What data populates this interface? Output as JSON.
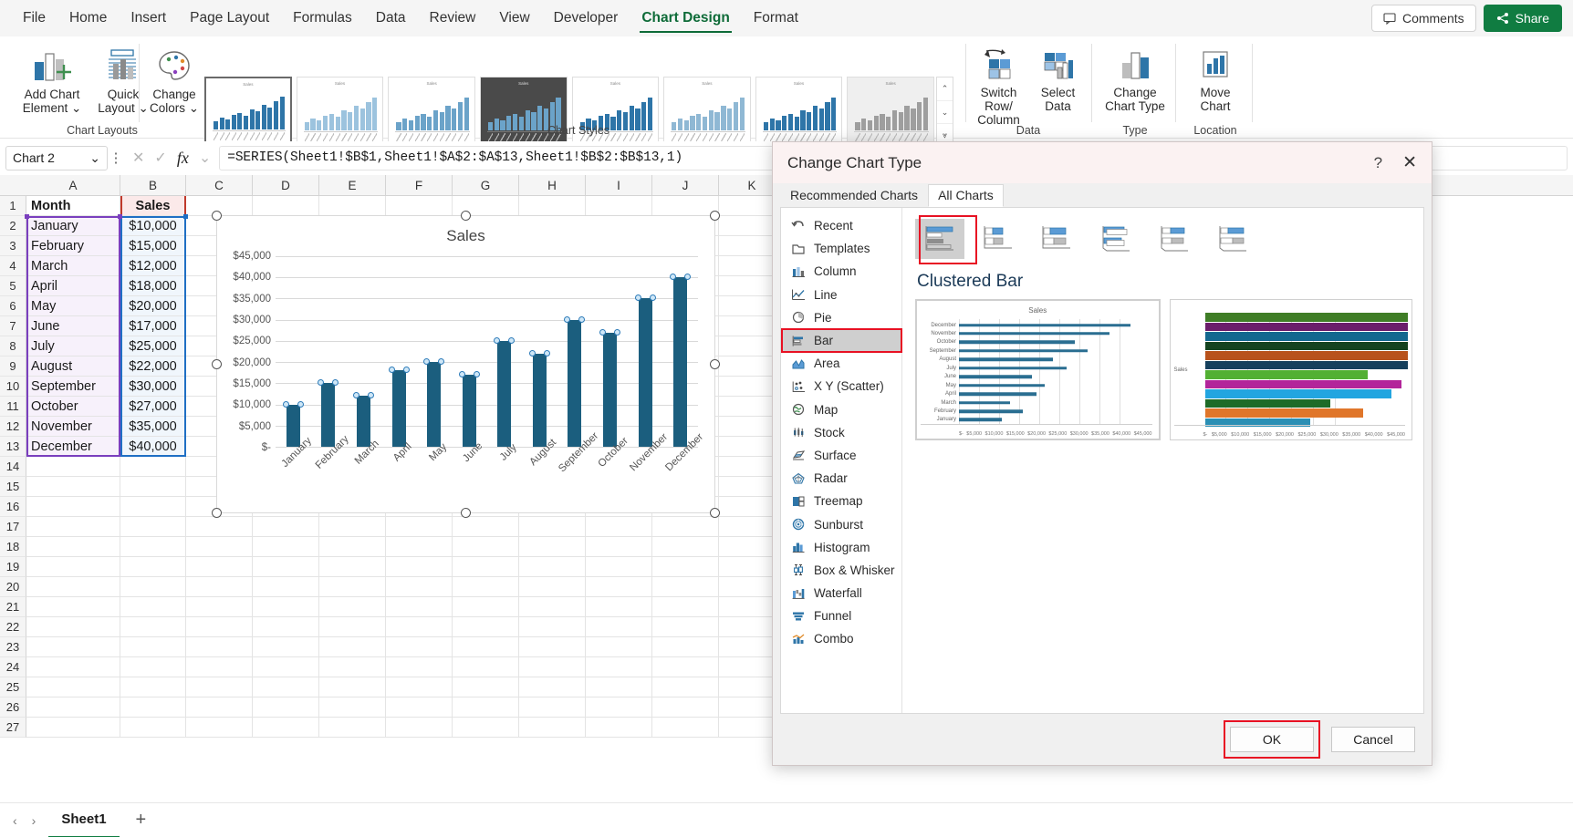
{
  "ribbon": {
    "tabs": [
      {
        "label": "File",
        "active": false
      },
      {
        "label": "Home",
        "active": false
      },
      {
        "label": "Insert",
        "active": false
      },
      {
        "label": "Page Layout",
        "active": false
      },
      {
        "label": "Formulas",
        "active": false
      },
      {
        "label": "Data",
        "active": false
      },
      {
        "label": "Review",
        "active": false
      },
      {
        "label": "View",
        "active": false
      },
      {
        "label": "Developer",
        "active": false
      },
      {
        "label": "Chart Design",
        "active": true
      },
      {
        "label": "Format",
        "active": false
      }
    ],
    "comments_label": "Comments",
    "share_label": "Share",
    "buttons": {
      "add_chart_element": "Add Chart\nElement",
      "add_chart_element_l1": "Add Chart",
      "add_chart_element_l2": "Element",
      "quick_layout_l1": "Quick",
      "quick_layout_l2": "Layout",
      "change_colors_l1": "Change",
      "change_colors_l2": "Colors",
      "switch_row_column_l1": "Switch Row/",
      "switch_row_column_l2": "Column",
      "select_data_l1": "Select",
      "select_data_l2": "Data",
      "change_chart_type_l1": "Change",
      "change_chart_type_l2": "Chart Type",
      "move_chart_l1": "Move",
      "move_chart_l2": "Chart"
    },
    "groups": {
      "chart_layouts": "Chart Layouts",
      "chart_styles": "Chart Styles",
      "data": "Data",
      "type": "Type",
      "location": "Location"
    },
    "gallery_thumb_title": "Sales"
  },
  "formula_bar": {
    "name_box_value": "Chart 2",
    "formula": "=SERIES(Sheet1!$B$1,Sheet1!$A$2:$A$13,Sheet1!$B$2:$B$13,1)",
    "cancel_icon": "✕",
    "confirm_icon": "✓",
    "fx_label": "fx",
    "dropdown_icon": "⌄"
  },
  "sheet": {
    "column_headers": [
      "A",
      "B",
      "C",
      "D",
      "E",
      "F",
      "G",
      "H",
      "I",
      "J",
      "K"
    ],
    "row_numbers": [
      1,
      2,
      3,
      4,
      5,
      6,
      7,
      8,
      9,
      10,
      11,
      12,
      13,
      14,
      15,
      16,
      17,
      18,
      19,
      20,
      21,
      22,
      23,
      24,
      25,
      26,
      27
    ],
    "header_row": {
      "month": "Month",
      "sales": "Sales"
    },
    "rows": [
      {
        "month": "January",
        "sales": "$10,000"
      },
      {
        "month": "February",
        "sales": "$15,000"
      },
      {
        "month": "March",
        "sales": "$12,000"
      },
      {
        "month": "April",
        "sales": "$18,000"
      },
      {
        "month": "May",
        "sales": "$20,000"
      },
      {
        "month": "June",
        "sales": "$17,000"
      },
      {
        "month": "July",
        "sales": "$25,000"
      },
      {
        "month": "August",
        "sales": "$22,000"
      },
      {
        "month": "September",
        "sales": "$30,000"
      },
      {
        "month": "October",
        "sales": "$27,000"
      },
      {
        "month": "November",
        "sales": "$35,000"
      },
      {
        "month": "December",
        "sales": "$40,000"
      }
    ],
    "tab_name": "Sheet1",
    "add_sheet_icon": "+",
    "nav_prev_icon": "‹",
    "nav_next_icon": "›"
  },
  "chart_data": {
    "type": "bar",
    "title": "Sales",
    "categories": [
      "January",
      "February",
      "March",
      "April",
      "May",
      "June",
      "July",
      "August",
      "September",
      "October",
      "November",
      "December"
    ],
    "values": [
      10000,
      15000,
      12000,
      18000,
      20000,
      17000,
      25000,
      22000,
      30000,
      27000,
      35000,
      40000
    ],
    "ytick_labels": [
      "$45,000",
      "$40,000",
      "$35,000",
      "$30,000",
      "$25,000",
      "$20,000",
      "$15,000",
      "$10,000",
      "$5,000",
      "$-"
    ],
    "ytick_values": [
      45000,
      40000,
      35000,
      30000,
      25000,
      20000,
      15000,
      10000,
      5000,
      0
    ],
    "ylim": [
      0,
      45000
    ],
    "xlabel": "",
    "ylabel": "",
    "grid": true,
    "legend": "none",
    "series_color": "#1b5e7e",
    "selected": true
  },
  "dialog": {
    "title": "Change Chart Type",
    "help_icon": "?",
    "close_icon": "✕",
    "tabs": [
      {
        "label": "Recommended Charts",
        "active": false
      },
      {
        "label": "All Charts",
        "active": true
      }
    ],
    "type_list": [
      {
        "label": "Recent",
        "icon": "recent-icon",
        "selected": false
      },
      {
        "label": "Templates",
        "icon": "templates-icon",
        "selected": false
      },
      {
        "label": "Column",
        "icon": "column-icon",
        "selected": false
      },
      {
        "label": "Line",
        "icon": "line-icon",
        "selected": false
      },
      {
        "label": "Pie",
        "icon": "pie-icon",
        "selected": false
      },
      {
        "label": "Bar",
        "icon": "bar-icon",
        "selected": true
      },
      {
        "label": "Area",
        "icon": "area-icon",
        "selected": false
      },
      {
        "label": "X Y (Scatter)",
        "icon": "scatter-icon",
        "selected": false
      },
      {
        "label": "Map",
        "icon": "map-icon",
        "selected": false
      },
      {
        "label": "Stock",
        "icon": "stock-icon",
        "selected": false
      },
      {
        "label": "Surface",
        "icon": "surface-icon",
        "selected": false
      },
      {
        "label": "Radar",
        "icon": "radar-icon",
        "selected": false
      },
      {
        "label": "Treemap",
        "icon": "treemap-icon",
        "selected": false
      },
      {
        "label": "Sunburst",
        "icon": "sunburst-icon",
        "selected": false
      },
      {
        "label": "Histogram",
        "icon": "histogram-icon",
        "selected": false
      },
      {
        "label": "Box & Whisker",
        "icon": "box-whisker-icon",
        "selected": false
      },
      {
        "label": "Waterfall",
        "icon": "waterfall-icon",
        "selected": false
      },
      {
        "label": "Funnel",
        "icon": "funnel-icon",
        "selected": false
      },
      {
        "label": "Combo",
        "icon": "combo-icon",
        "selected": false
      }
    ],
    "subtype_selected_index": 0,
    "subtype_count": 6,
    "subtype_name": "Clustered Bar",
    "preview1": {
      "title": "Sales",
      "categories": [
        "December",
        "November",
        "October",
        "September",
        "August",
        "July",
        "June",
        "May",
        "April",
        "March",
        "February",
        "January"
      ],
      "values": [
        40000,
        35000,
        27000,
        30000,
        22000,
        25000,
        17000,
        20000,
        18000,
        12000,
        15000,
        10000
      ],
      "xticks": [
        "$-",
        "$5,000",
        "$10,000",
        "$15,000",
        "$20,000",
        "$25,000",
        "$30,000",
        "$35,000",
        "$40,000",
        "$45,000"
      ]
    },
    "preview2": {
      "series_label": "Sales",
      "xticks": [
        "$-",
        "$5,000",
        "$10,000",
        "$15,000",
        "$20,000",
        "$25,000",
        "$30,000",
        "$35,000",
        "$40,000",
        "$45,000"
      ],
      "colors": [
        "#3f7d26",
        "#6b1d6b",
        "#13688f",
        "#14431f",
        "#b8521c",
        "#16405c",
        "#52b033",
        "#b3249a",
        "#22a5e0",
        "#1d6b28",
        "#e0762a",
        "#2a8fb5"
      ],
      "lengths": [
        100,
        100,
        100,
        100,
        100,
        100,
        80,
        97,
        92,
        62,
        78,
        52
      ]
    },
    "ok_label": "OK",
    "cancel_label": "Cancel"
  },
  "colors": {
    "accent_green": "#107c41",
    "annotation_red": "#e81123",
    "series_blue": "#1b5e7e",
    "dialog_title_bg": "#fbf2f2"
  }
}
